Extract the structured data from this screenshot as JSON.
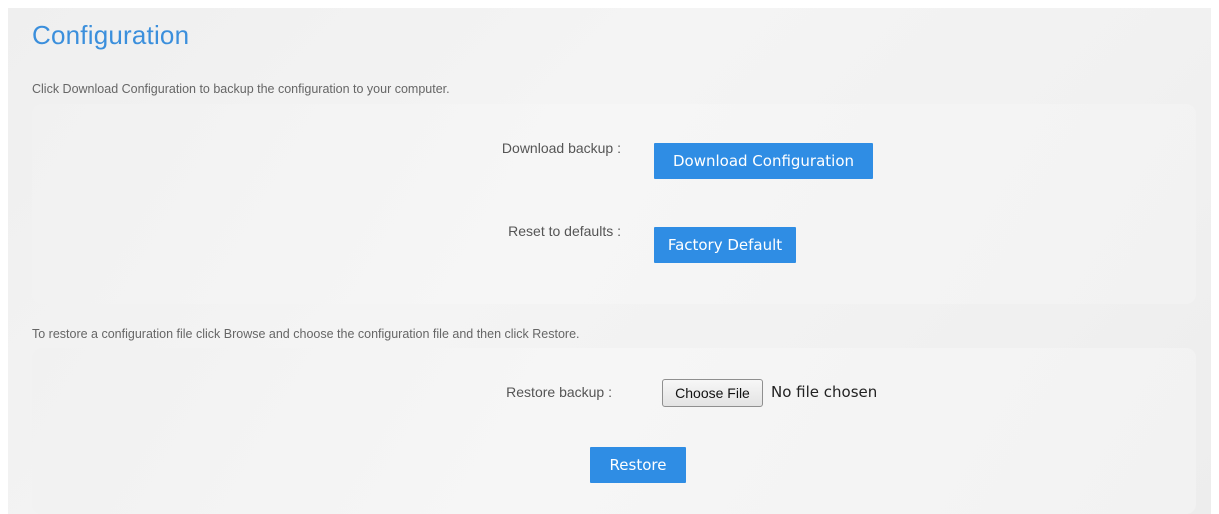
{
  "page": {
    "title": "Configuration"
  },
  "download_section": {
    "description": "Click Download Configuration to backup the configuration to your computer.",
    "download_label": "Download backup :",
    "download_button": "Download Configuration",
    "reset_label": "Reset to defaults :",
    "reset_button": "Factory Default"
  },
  "restore_section": {
    "description": "To restore a configuration file click Browse and choose the configuration file and then click Restore.",
    "restore_label": "Restore backup :",
    "choose_file_button": "Choose File",
    "file_status": "No file chosen",
    "restore_button": "Restore"
  },
  "colors": {
    "accent": "#2f8de4",
    "title": "#3b8fdc",
    "panel": "#f2f2f2"
  }
}
